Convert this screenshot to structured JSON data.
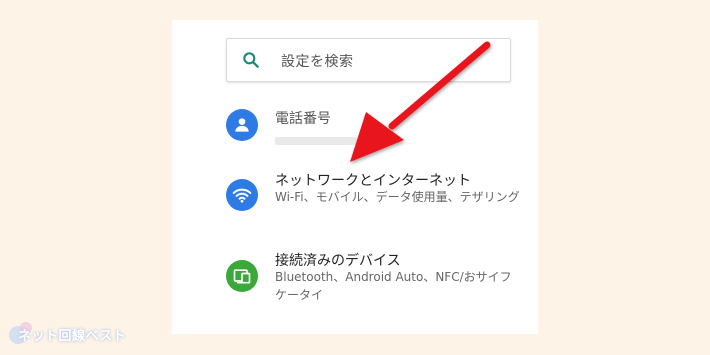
{
  "search": {
    "placeholder": "設定を検索",
    "icon": "search-icon",
    "icon_color": "#1a8a7a"
  },
  "items": [
    {
      "title": "電話番号",
      "subtitle": "",
      "icon": "account-icon",
      "color": "#2f7be5"
    },
    {
      "title": "ネットワークとインターネット",
      "subtitle": "Wi-Fi、モバイル、データ使用量、テザリング",
      "icon": "wifi-icon",
      "color": "#2f7be5"
    },
    {
      "title": "接続済みのデバイス",
      "subtitle": "Bluetooth、Android Auto、NFC/おサイフケータイ",
      "icon": "devices-icon",
      "color": "#3aa83a"
    }
  ],
  "annotation": {
    "arrow_color": "#e8141c"
  },
  "watermark": {
    "text": "ネット回線ベスト"
  }
}
